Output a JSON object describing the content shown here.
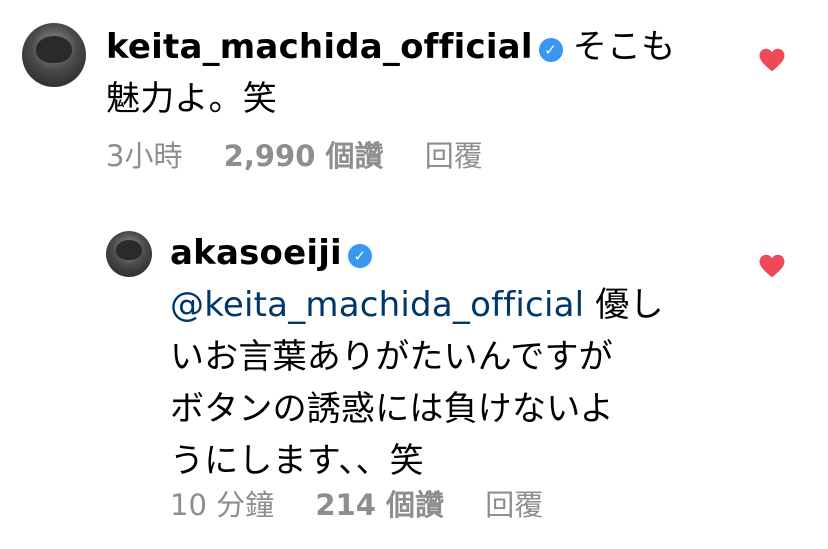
{
  "comments": [
    {
      "username": "keita_machida_official",
      "verified": true,
      "text_line1": "そこも",
      "text_line2": "魅力よ。笑",
      "time": "3小時",
      "likes": "2,990 個讚",
      "reply_label": "回覆"
    },
    {
      "username": "akasoeiji",
      "verified": true,
      "mention": "@keita_machida_official",
      "text_line1": "優し",
      "text_line2": "いお言葉ありがたいんですが",
      "text_line3": "ボタンの誘惑には負けないよ",
      "text_line4": "うにします、、笑",
      "time": "10 分鐘",
      "likes": "214 個讚",
      "reply_label": "回覆"
    }
  ],
  "colors": {
    "heart": "#ed4956",
    "verified_badge": "#3897f0",
    "mention": "#00376b",
    "meta_text": "#8e8e8e"
  },
  "icons": {
    "like": "heart-icon",
    "verified": "verified-badge-icon"
  }
}
